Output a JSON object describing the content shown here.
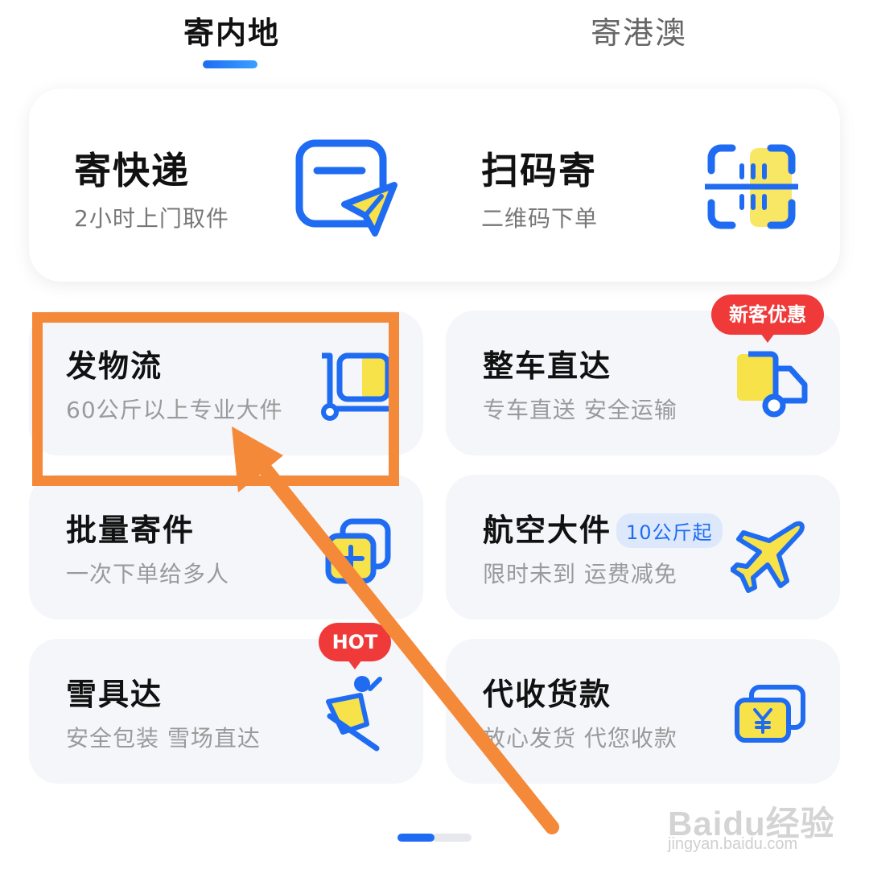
{
  "tabs": {
    "active": "寄内地",
    "inactive": "寄港澳"
  },
  "top_card": {
    "send_express": {
      "title": "寄快递",
      "sub": "2小时上门取件"
    },
    "scan_send": {
      "title": "扫码寄",
      "sub": "二维码下单"
    }
  },
  "cards": {
    "logistics": {
      "title": "发物流",
      "sub": "60公斤以上专业大件"
    },
    "truck": {
      "title": "整车直达",
      "sub": "专车直送 安全运输",
      "badge": "新客优惠"
    },
    "batch": {
      "title": "批量寄件",
      "sub": "一次下单给多人"
    },
    "air": {
      "title": "航空大件",
      "sub": "限时未到 运费减免",
      "tag": "10公斤起"
    },
    "ski": {
      "title": "雪具达",
      "sub": "安全包装 雪场直达",
      "badge": "HOT"
    },
    "cod": {
      "title": "代收货款",
      "sub": "放心发货 代您收款"
    }
  },
  "watermark": {
    "logo": "Baidu经验",
    "url": "jingyan.baidu.com"
  },
  "colors": {
    "accent": "#1f6cf3",
    "highlight": "#f5893a",
    "badge": "#f03a3a",
    "yellow": "#f7e24a"
  },
  "icons": [
    "send-plane-icon",
    "scan-code-icon",
    "cart-box-icon",
    "truck-icon",
    "batch-add-icon",
    "airplane-icon",
    "snowboard-icon",
    "yen-money-icon"
  ]
}
